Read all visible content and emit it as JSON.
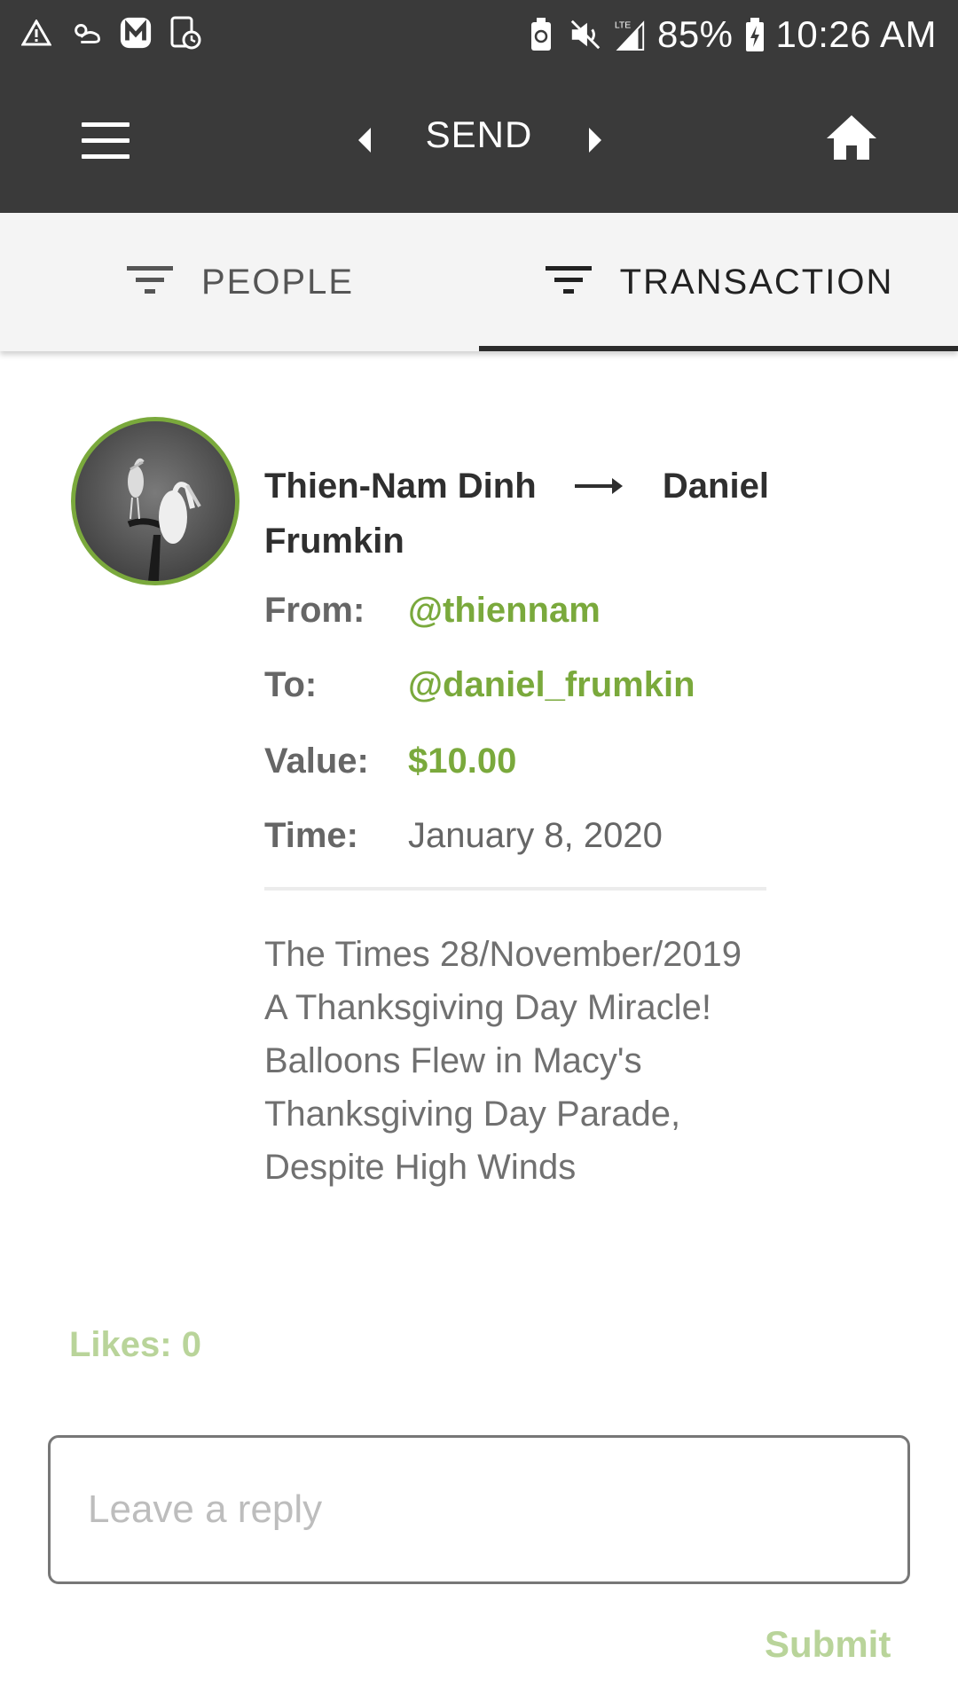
{
  "status_bar": {
    "battery_percent": "85%",
    "time": "10:26 AM",
    "network": "LTE"
  },
  "app_bar": {
    "title": "SEND"
  },
  "tabs": [
    {
      "label": "PEOPLE",
      "selected": false
    },
    {
      "label": "TRANSACTION",
      "selected": true
    }
  ],
  "transaction": {
    "from_name": "Thien-Nam Dinh",
    "to_name": "Daniel Frumkin",
    "from_label": "From:",
    "from_handle": "@thiennam",
    "to_label": "To:",
    "to_handle": "@daniel_frumkin",
    "value_label": "Value:",
    "value": "$10.00",
    "time_label": "Time:",
    "time": "January 8, 2020",
    "message": "The Times 28/November/2019 A Thanksgiving Day Miracle! Balloons Flew in Macy's Thanksgiving Day Parade, Despite High Winds"
  },
  "likes": "Likes: 0",
  "reply": {
    "placeholder": "Leave a reply",
    "submit_label": "Submit"
  },
  "colors": {
    "accent": "#7aa93c",
    "accent_muted": "#b9d49a",
    "app_bar": "#3a3a3a"
  }
}
